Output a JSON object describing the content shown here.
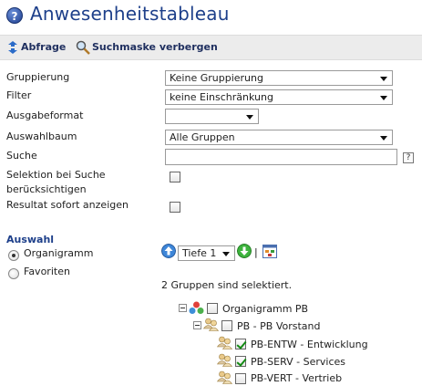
{
  "header": {
    "title": "Anwesenheitstableau",
    "help_icon": "?"
  },
  "toolbar": {
    "query_label": "Abfrage",
    "toggle_search_label": "Suchmaske verbergen"
  },
  "form": {
    "grouping_label": "Gruppierung",
    "grouping_value": "Keine Gruppierung",
    "filter_label": "Filter",
    "filter_value": "keine Einschränkung",
    "output_label": "Ausgabeformat",
    "output_value": "",
    "tree_label": "Auswahlbaum",
    "tree_value": "Alle Gruppen",
    "search_label": "Suche",
    "search_value": "",
    "search_help": "?",
    "selection_label_line1": "Selektion bei Suche",
    "selection_label_line2": "berücksichtigen",
    "selection_checked": false,
    "instant_label": "Resultat sofort anzeigen",
    "instant_checked": false
  },
  "selection": {
    "title": "Auswahl",
    "options": [
      {
        "label": "Organigramm",
        "selected": true
      },
      {
        "label": "Favoriten",
        "selected": false
      }
    ],
    "depth_value": "Tiefe 1",
    "separator": "|",
    "status_text": "2 Gruppen sind selektiert.",
    "tree": [
      {
        "label": "Organigramm PB",
        "checked": false,
        "level": 0,
        "expanded": true
      },
      {
        "label": "PB - PB Vorstand",
        "checked": false,
        "level": 1,
        "expanded": true
      },
      {
        "label": "PB-ENTW - Entwicklung",
        "checked": true,
        "level": 2
      },
      {
        "label": "PB-SERV - Services",
        "checked": true,
        "level": 2
      },
      {
        "label": "PB-VERT - Vertrieb",
        "checked": false,
        "level": 2
      }
    ]
  },
  "colors": {
    "title": "#1d3f8a",
    "toolbar_bg": "#ececec",
    "check": "#128a12"
  }
}
